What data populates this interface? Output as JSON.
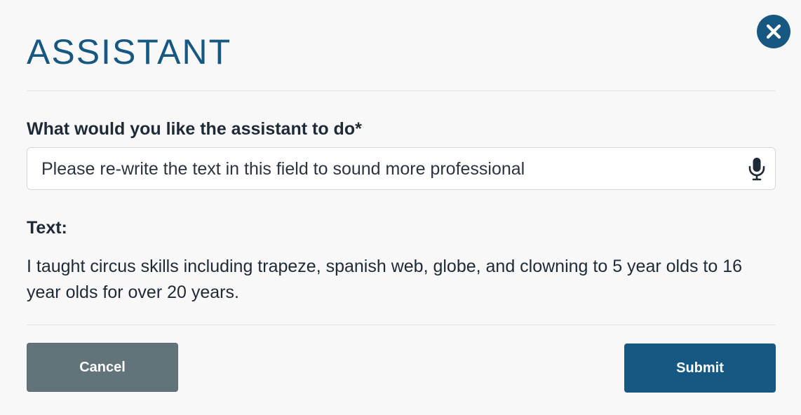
{
  "dialog": {
    "title": "ASSISTANT",
    "close_icon": "close-icon",
    "accent_color": "#175883"
  },
  "prompt": {
    "label": "What would you like the assistant to do*",
    "value": "Please re-write the text in this field to sound more professional",
    "mic_icon": "microphone-icon"
  },
  "text_section": {
    "label": "Text:",
    "content": "I taught circus skills including trapeze, spanish web, globe, and clowning to 5 year olds to 16 year olds for over 20 years."
  },
  "actions": {
    "cancel_label": "Cancel",
    "submit_label": "Submit",
    "cancel_color": "#627479",
    "submit_color": "#175883"
  }
}
